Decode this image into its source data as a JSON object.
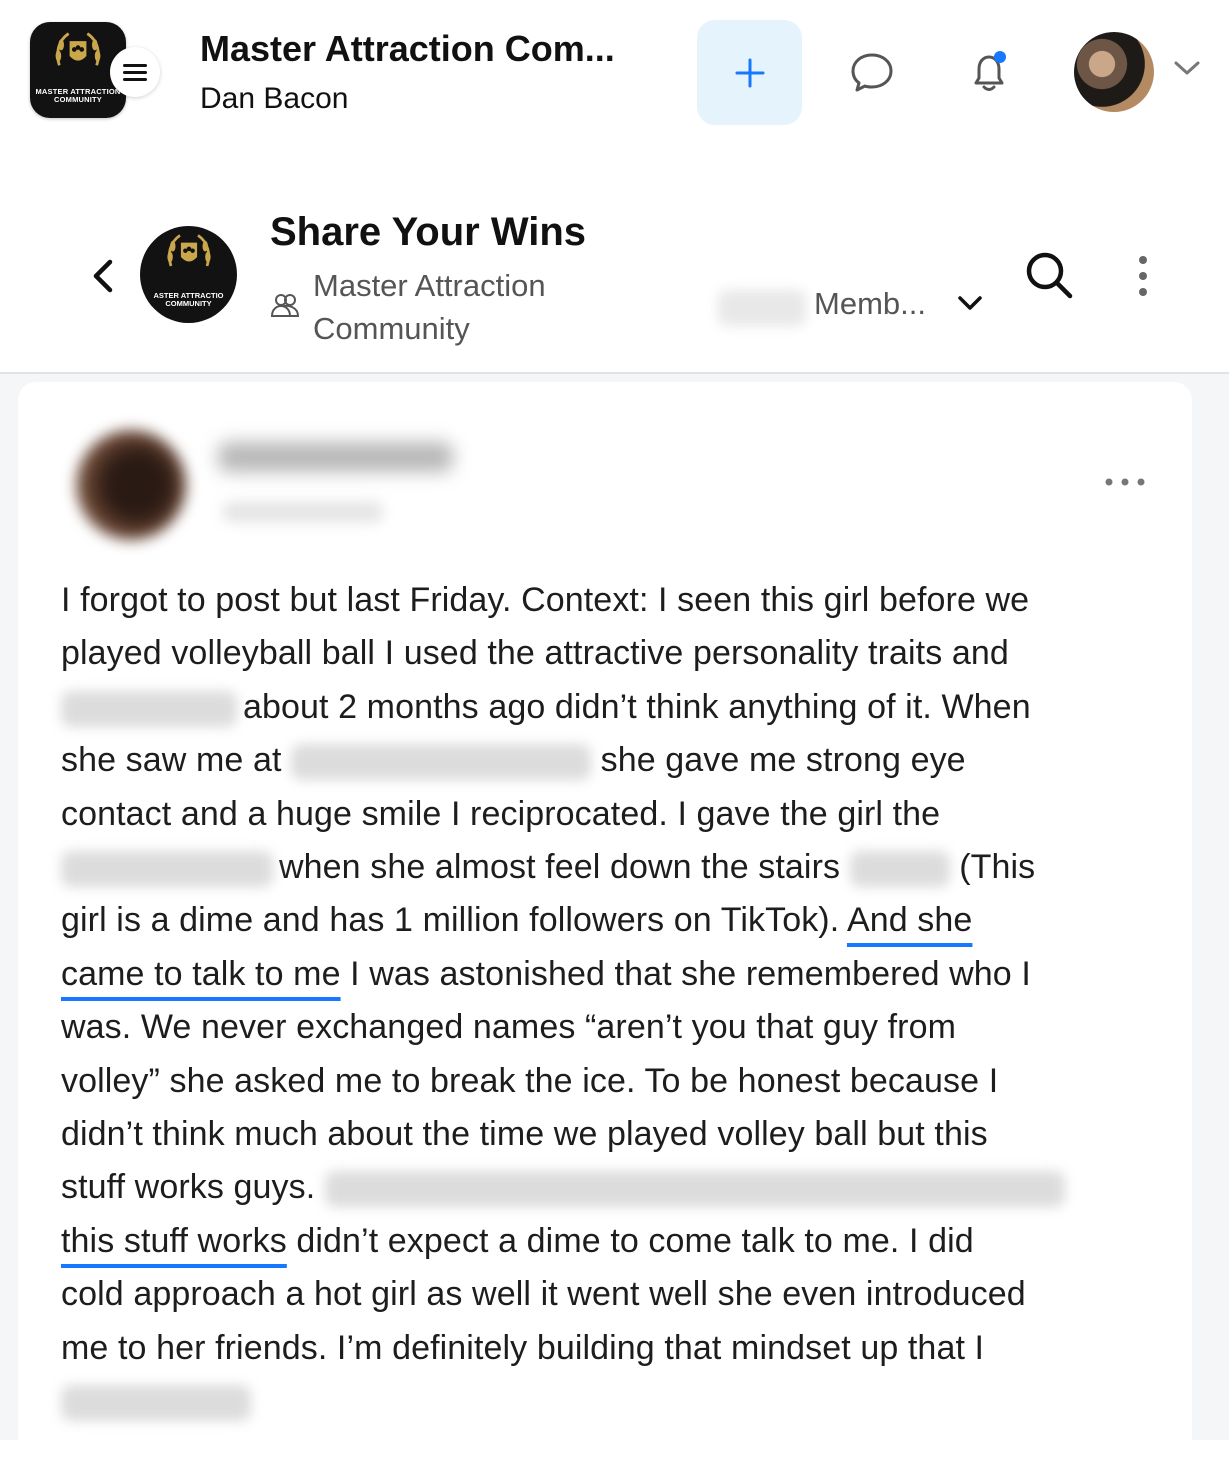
{
  "topbar": {
    "app_title": "Master Attraction Com...",
    "app_subtitle": "Dan Bacon",
    "logo_text": "MASTER ATTRACTION COMMUNITY",
    "icons": [
      "menu-icon",
      "plus-icon",
      "chat-icon",
      "bell-icon",
      "chevron-down-icon"
    ],
    "accent_color": "#1677ff",
    "notification_dot_color": "#1677ff"
  },
  "group": {
    "title": "Share Your Wins",
    "community_name": "Master Attraction Community",
    "members_label": "Memb...",
    "logo_text": "ASTER ATTRACTIO COMMUNITY",
    "icons": [
      "back-chevron-icon",
      "community-icon",
      "chevron-down-icon",
      "search-icon",
      "more-vertical-icon"
    ]
  },
  "post": {
    "more_icon": "more-horizontal-icon",
    "lines": [
      "I forgot to post but last Friday. Context: I seen this girl before we",
      "played volleyball ball I used the attractive personality traits and",
      "about 2 months ago didn’t think anything of it. When",
      "she saw me at",
      "she gave me strong eye",
      "contact and a huge smile I reciprocated. I gave the girl the",
      "when she almost feel down the stairs",
      "(This",
      "girl is a dime and has 1 million followers on TikTok).",
      "And she",
      "came to talk to me",
      "I was astonished that she remembered who I",
      "was. We never exchanged names “aren’t you that guy from",
      "volley” she asked me to break the ice. To be honest because I",
      "didn’t think much about the time we played volley ball but this",
      "stuff works guys.",
      "this stuff works",
      "didn’t expect a dime to come talk to me. I did",
      "cold approach a hot girl as well it went well she even introduced",
      "me to her friends. I’m definitely building that mindset up that I"
    ]
  }
}
